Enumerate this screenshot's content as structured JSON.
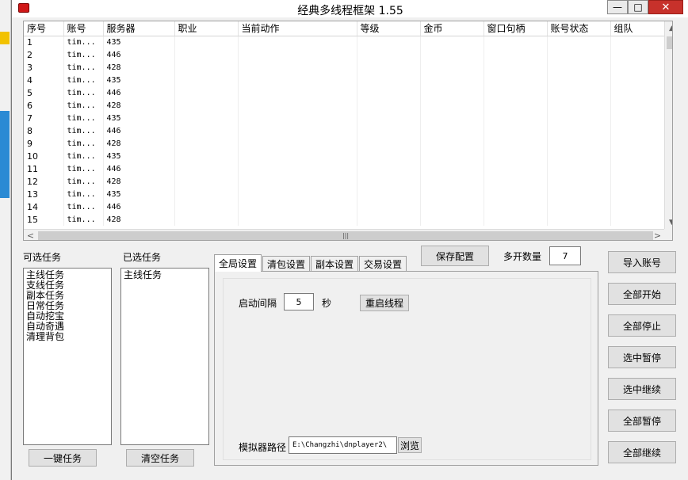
{
  "window": {
    "title": "经典多线程框架 1.55",
    "min_glyph": "—",
    "max_glyph": "□",
    "close_glyph": "✕"
  },
  "table": {
    "columns": [
      "序号",
      "账号",
      "服务器",
      "职业",
      "当前动作",
      "等级",
      "金币",
      "窗口句柄",
      "账号状态",
      "组队"
    ],
    "rows": [
      [
        "1",
        "tim...",
        "435"
      ],
      [
        "2",
        "tim...",
        "446"
      ],
      [
        "3",
        "tim...",
        "428"
      ],
      [
        "4",
        "tim...",
        "435"
      ],
      [
        "5",
        "tim...",
        "446"
      ],
      [
        "6",
        "tim...",
        "428"
      ],
      [
        "7",
        "tim...",
        "435"
      ],
      [
        "8",
        "tim...",
        "446"
      ],
      [
        "9",
        "tim...",
        "428"
      ],
      [
        "10",
        "tim...",
        "435"
      ],
      [
        "11",
        "tim...",
        "446"
      ],
      [
        "12",
        "tim...",
        "428"
      ],
      [
        "13",
        "tim...",
        "435"
      ],
      [
        "14",
        "tim...",
        "446"
      ],
      [
        "15",
        "tim...",
        "428"
      ]
    ]
  },
  "scroll": {
    "left": "<",
    "right": ">",
    "up": "▲",
    "down": "▼",
    "grip": "|||"
  },
  "available_tasks": {
    "label": "可选任务",
    "items": [
      "主线任务",
      "支线任务",
      "副本任务",
      "日常任务",
      "自动挖宝",
      "自动奇遇",
      "清理背包"
    ],
    "button": "一键任务"
  },
  "selected_tasks": {
    "label": "已选任务",
    "items": [
      "主线任务"
    ],
    "button": "清空任务"
  },
  "tabs": [
    "全局设置",
    "清包设置",
    "副本设置",
    "交易设置"
  ],
  "global_settings": {
    "interval_label": "启动间隔",
    "interval_value": "5",
    "interval_unit": "秒",
    "restart_button": "重启线程",
    "emulator_label": "模拟器路径",
    "emulator_path": "E:\\Changzhi\\dnplayer2\\",
    "browse_button": "浏览"
  },
  "save_button": "保存配置",
  "multi_open": {
    "label": "多开数量",
    "value": "7"
  },
  "actions": [
    "导入账号",
    "全部开始",
    "全部停止",
    "选中暂停",
    "选中继续",
    "全部暂停",
    "全部继续"
  ]
}
